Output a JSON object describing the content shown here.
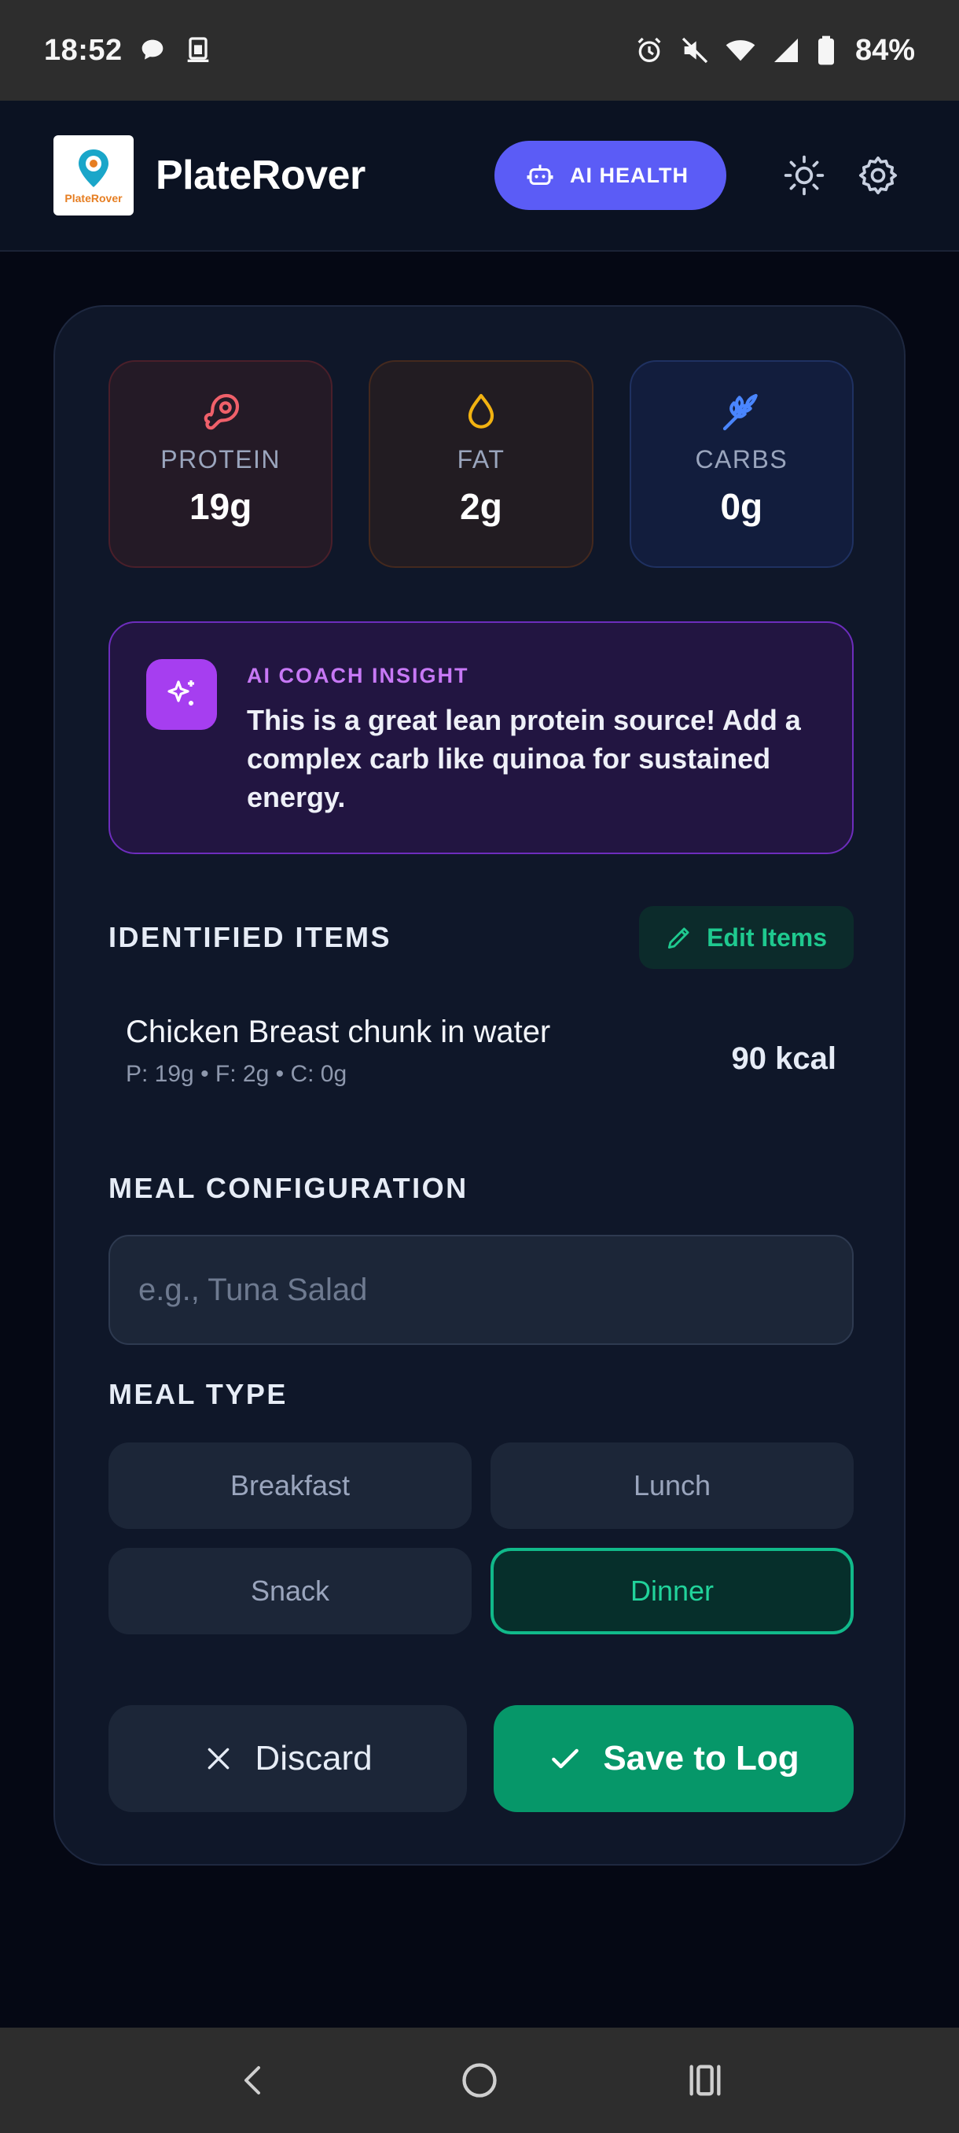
{
  "status_bar": {
    "time": "18:52",
    "battery": "84%"
  },
  "header": {
    "app_name": "PlateRover",
    "logo_text": "PlateRover",
    "ai_health_label": "AI HEALTH"
  },
  "macros": [
    {
      "label": "PROTEIN",
      "value": "19g",
      "icon": "meat-icon",
      "color": "#f0606a"
    },
    {
      "label": "FAT",
      "value": "2g",
      "icon": "droplet-icon",
      "color": "#f2b211"
    },
    {
      "label": "CARBS",
      "value": "0g",
      "icon": "wheat-icon",
      "color": "#4a86ff"
    }
  ],
  "insight": {
    "title": "AI COACH INSIGHT",
    "text": "This is a great lean protein source! Add a complex carb like quinoa for sustained energy."
  },
  "identified": {
    "heading": "IDENTIFIED ITEMS",
    "edit_label": "Edit Items",
    "items": [
      {
        "name": "Chicken Breast chunk in water",
        "macros": "P: 19g • F: 2g • C: 0g",
        "kcal": "90 kcal"
      }
    ]
  },
  "config": {
    "heading": "MEAL CONFIGURATION",
    "input_value": "",
    "placeholder": "e.g., Tuna Salad"
  },
  "meal_type": {
    "heading": "MEAL TYPE",
    "options": [
      "Breakfast",
      "Lunch",
      "Snack",
      "Dinner"
    ],
    "selected": "Dinner"
  },
  "actions": {
    "discard_label": "Discard",
    "save_label": "Save to Log"
  },
  "colors": {
    "accent_green": "#069769",
    "accent_indigo": "#5b5cf6",
    "accent_purple": "#a63ef0"
  }
}
